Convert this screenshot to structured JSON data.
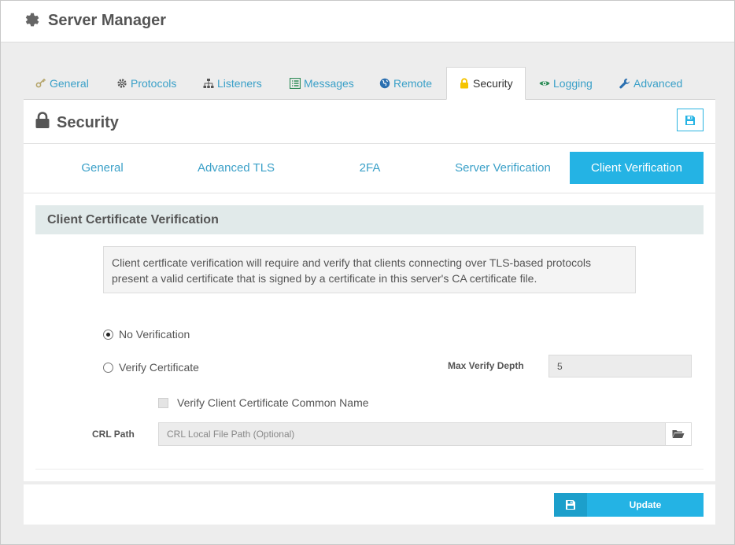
{
  "app": {
    "title": "Server Manager",
    "icon": "gear-icon"
  },
  "tabs": [
    {
      "label": "General",
      "icon": "key-icon",
      "color": "#b5a56a"
    },
    {
      "label": "Protocols",
      "icon": "cog-icon",
      "color": "#555555"
    },
    {
      "label": "Listeners",
      "icon": "sitemap-icon",
      "color": "#555555"
    },
    {
      "label": "Messages",
      "icon": "list-icon",
      "color": "#2e8b57"
    },
    {
      "label": "Remote",
      "icon": "globe-icon",
      "color": "#2a6fb0"
    },
    {
      "label": "Security",
      "icon": "lock-icon",
      "color": "#f5c400"
    },
    {
      "label": "Logging",
      "icon": "eye-icon",
      "color": "#2e8b57"
    },
    {
      "label": "Advanced",
      "icon": "wrench-icon",
      "color": "#2a6fb0"
    }
  ],
  "active_tab": "Security",
  "panel": {
    "title": "Security",
    "icon": "lock-icon"
  },
  "subtabs": [
    "General",
    "Advanced TLS",
    "2FA",
    "Server Verification",
    "Client Verification"
  ],
  "active_subtab": "Client Verification",
  "section": {
    "title": "Client Certificate Verification"
  },
  "info_text_line1": "Client certficate verification will require and verify that clients connecting over TLS-based protocols",
  "info_text_line2": "present a valid certificate that is signed by a certificate in this server's CA certificate file.",
  "options": {
    "no_verification": {
      "label": "No Verification",
      "checked": true
    },
    "verify_certificate": {
      "label": "Verify Certificate",
      "checked": false
    },
    "max_verify_depth_label": "Max Verify Depth",
    "max_verify_depth_value": "5",
    "verify_common_name": {
      "label": "Verify Client Certificate Common Name",
      "checked": false
    },
    "crl_path_label": "CRL Path",
    "crl_path_placeholder": "CRL Local File Path (Optional)"
  },
  "footer": {
    "update_label": "Update"
  },
  "colors": {
    "accent": "#24b3e4",
    "link": "#3aa0c8",
    "section_bg": "#e1eaea"
  }
}
